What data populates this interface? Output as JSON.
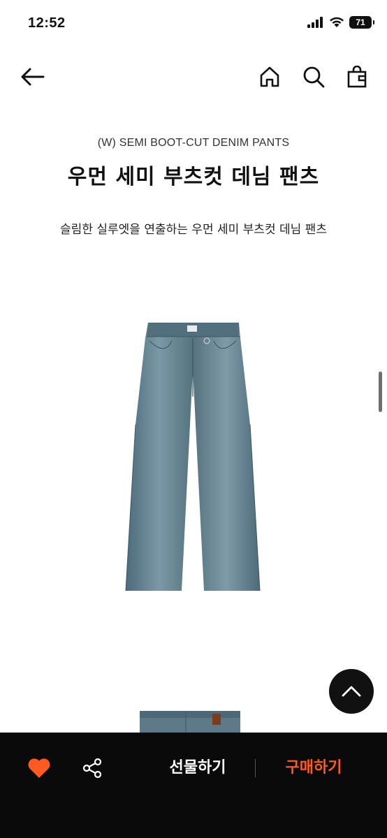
{
  "status_bar": {
    "time": "12:52",
    "battery_level": "71"
  },
  "nav": {
    "back_icon": "arrow-left-icon",
    "home_icon": "home-icon",
    "search_icon": "search-icon",
    "bag_icon": "shopping-bag-icon"
  },
  "product": {
    "english_name": "(W) SEMI BOOT-CUT DENIM PANTS",
    "korean_name": "우먼 세미 부츠컷 데님 팬츠",
    "description": "슬림한 실루엣을 연출하는 우먼 세미 부츠컷 데님 팬츠"
  },
  "bottom_bar": {
    "heart_icon": "heart-icon",
    "share_icon": "share-icon",
    "gift_label": "선물하기",
    "buy_label": "구매하기"
  },
  "colors": {
    "accent": "#ff5a1f",
    "heart": "#ff5a1f",
    "bottom_bar_bg": "#0a0a0a",
    "denim": "#5f7c8c"
  }
}
